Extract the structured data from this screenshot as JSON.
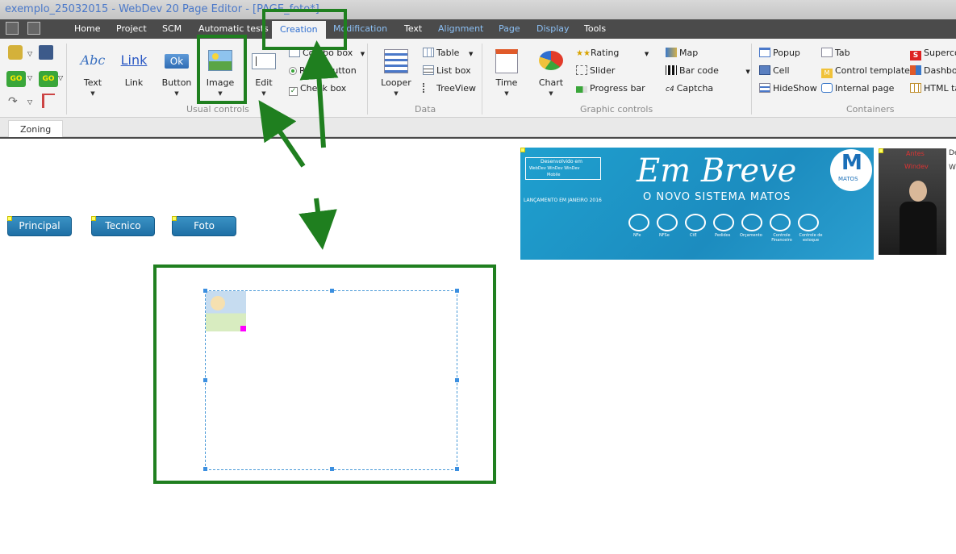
{
  "window": {
    "title": "exemplo_25032015 - WebDev 20  Page Editor - [PAGE_foto*]"
  },
  "menu": {
    "tabs": [
      {
        "label": "Home"
      },
      {
        "label": "Project"
      },
      {
        "label": "SCM"
      },
      {
        "label": "Automatic tests"
      },
      {
        "label": "Creation"
      },
      {
        "label": "Modification"
      },
      {
        "label": "Text"
      },
      {
        "label": "Alignment"
      },
      {
        "label": "Page"
      },
      {
        "label": "Display"
      },
      {
        "label": "Tools"
      }
    ],
    "active_tab": "Creation"
  },
  "ribbon": {
    "usual": {
      "group_label": "Usual controls",
      "text": {
        "label": "Text",
        "icon_text": "Abc"
      },
      "link": {
        "label": "Link",
        "icon_text": "Link"
      },
      "button": {
        "label": "Button",
        "icon_text": "Ok"
      },
      "image": {
        "label": "Image"
      },
      "edit": {
        "label": "Edit"
      },
      "combo": {
        "label": "Combo box"
      },
      "radio": {
        "label": "Radio button"
      },
      "check": {
        "label": "Check box"
      }
    },
    "data": {
      "group_label": "Data",
      "looper": {
        "label": "Looper"
      },
      "table": {
        "label": "Table"
      },
      "listbox": {
        "label": "List box"
      },
      "treeview": {
        "label": "TreeView"
      }
    },
    "graphic": {
      "group_label": "Graphic controls",
      "time": {
        "label": "Time"
      },
      "chart": {
        "label": "Chart"
      },
      "rating": {
        "label": "Rating"
      },
      "slider": {
        "label": "Slider"
      },
      "progress": {
        "label": "Progress bar"
      },
      "map": {
        "label": "Map"
      },
      "barcode": {
        "label": "Bar code"
      },
      "captcha": {
        "label": "Captcha"
      }
    },
    "containers": {
      "group_label": "Containers",
      "popup": {
        "label": "Popup"
      },
      "cell": {
        "label": "Cell"
      },
      "hideshow": {
        "label": "HideShow"
      },
      "tab": {
        "label": "Tab"
      },
      "control_template": {
        "label": "Control template"
      },
      "internal_page": {
        "label": "Internal page"
      },
      "supercontrol": {
        "label": "Superco"
      },
      "dashboard": {
        "label": "Dashbo"
      },
      "html_table": {
        "label": "HTML ta"
      }
    }
  },
  "subbar": {
    "zoning_label": "Zoning"
  },
  "page": {
    "buttons": [
      {
        "label": "Principal"
      },
      {
        "label": "Tecnico"
      },
      {
        "label": "Foto"
      }
    ],
    "banner": {
      "small_top": "Desenvolvido em",
      "small_mid": "WebDev  WinDev  WinDev",
      "small_bot": "Mobile",
      "launch": "LANÇAMENTO EM JANEIRO 2016",
      "headline": "Em Breve",
      "subheadline": "O NOVO SISTEMA MATOS",
      "logo_letter": "M",
      "logo_name": "MATOS",
      "icons": [
        "NFe",
        "NFSe",
        "CtE",
        "Pedidos",
        "Orçamento",
        "Controle Financeiro",
        "Controle de estoque"
      ]
    },
    "photo": {
      "caption_top": "Antes",
      "caption_bot": "Windev"
    },
    "edge_text": [
      "De",
      "Wi"
    ]
  },
  "colors": {
    "titlebar_text": "#4a78c9",
    "menubar_bg": "#4b4b4b",
    "active_tab_text": "#2f6fd0",
    "annotation_green": "#1f7f1f",
    "page_button_bg": "#2580b8",
    "banner_bg": "#1fa0cf"
  }
}
